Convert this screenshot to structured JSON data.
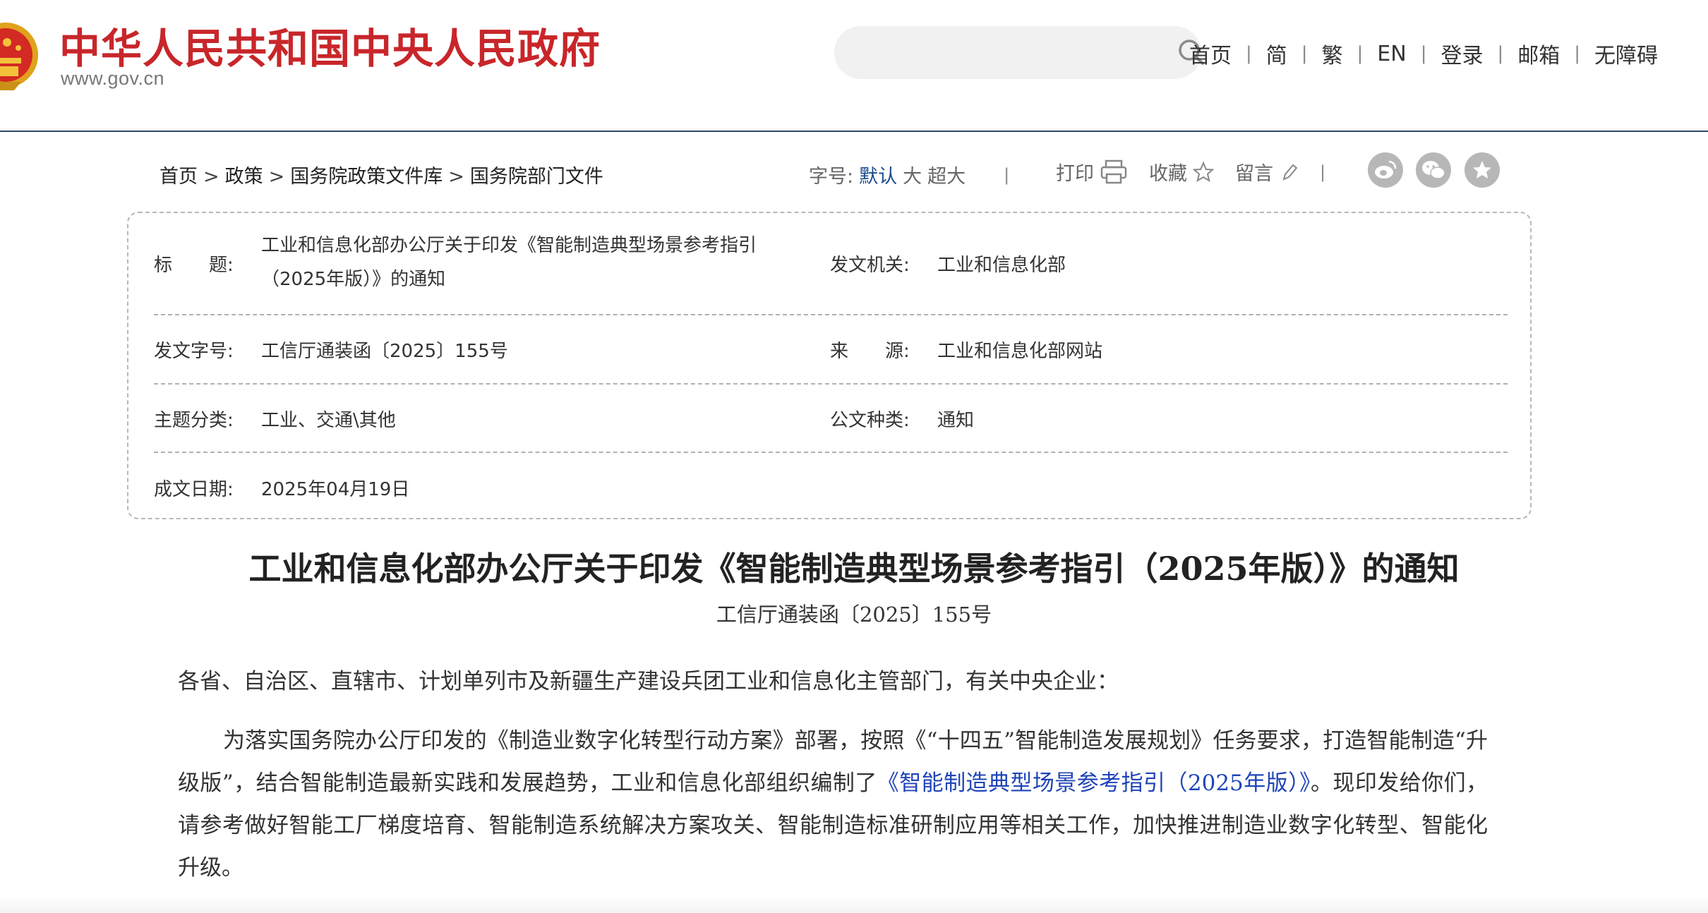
{
  "header": {
    "site_name": "中华人民共和国中央人民政府",
    "site_url": "www.gov.cn",
    "search": {
      "placeholder": ""
    },
    "nav": [
      "首页",
      "简",
      "繁",
      "EN",
      "登录",
      "邮箱",
      "无障碍"
    ]
  },
  "breadcrumb": [
    "首页",
    "政策",
    "国务院政策文件库",
    "国务院部门文件"
  ],
  "breadcrumb_separator": ">",
  "font_size": {
    "label": "字号:",
    "options": [
      "默认",
      "大",
      "超大"
    ],
    "selected": "默认"
  },
  "tools": {
    "print": "打印",
    "favorite": "收藏",
    "comment": "留言",
    "separator": "|"
  },
  "share": [
    "weibo-icon",
    "wechat-icon",
    "favorite-star-icon"
  ],
  "info": {
    "title_label": "标　　题:",
    "title_value_line1": "工业和信息化部办公厅关于印发《智能制造典型场景参考指引",
    "title_value_line2": "（2025年版）》的通知",
    "issuer_label": "发文机关:",
    "issuer_value": "工业和信息化部",
    "doc_no_label": "发文字号:",
    "doc_no_value": "工信厅通装函〔2025〕155号",
    "source_label": "来　　源:",
    "source_value": "工业和信息化部网站",
    "category_label": "主题分类:",
    "category_value": "工业、交通\\其他",
    "doc_type_label": "公文种类:",
    "doc_type_value": "通知",
    "date_label": "成文日期:",
    "date_value": "2025年04月19日"
  },
  "article": {
    "title": "工业和信息化部办公厅关于印发《智能制造典型场景参考指引（2025年版）》的通知",
    "doc_number": "工信厅通装函〔2025〕155号",
    "addressee": "各省、自治区、直辖市、计划单列市及新疆生产建设兵团工业和信息化主管部门，有关中央企业：",
    "body_before_link": "为落实国务院办公厅印发的《制造业数字化转型行动方案》部署，按照《“十四五”智能制造发展规划》任务要求，打造智能制造“升级版”，结合智能制造最新实践和发展趋势，工业和信息化部组织编制了",
    "body_link": "《智能制造典型场景参考指引（2025年版）》",
    "body_after_link": "。现印发给你们，请参考做好智能工厂梯度培育、智能制造系统解决方案攻关、智能制造标准研制应用等相关工作，加快推进制造业数字化转型、智能化升级。"
  },
  "colors": {
    "brand_red": "#c8262a",
    "link_blue": "#1f44b8",
    "active_blue": "#1a4b8c",
    "header_rule": "#2d4a6a"
  }
}
